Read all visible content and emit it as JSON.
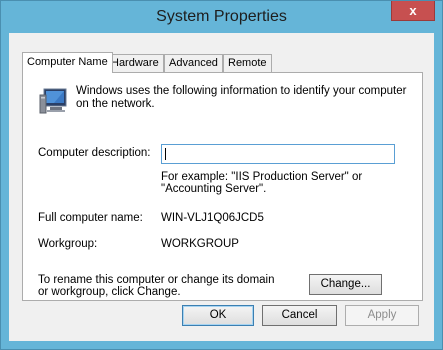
{
  "window": {
    "title": "System Properties",
    "close_label": "x"
  },
  "tabs": [
    {
      "label": "Computer Name",
      "active": true
    },
    {
      "label": "Hardware",
      "active": false
    },
    {
      "label": "Advanced",
      "active": false
    },
    {
      "label": "Remote",
      "active": false
    }
  ],
  "panel": {
    "intro": "Windows uses the following information to identify your computer on the network.",
    "description_label": "Computer description:",
    "description_value": "",
    "example_text": "For example: \"IIS Production Server\" or \"Accounting Server\".",
    "full_name_label": "Full computer name:",
    "full_name_value": "WIN-VLJ1Q06JCD5",
    "workgroup_label": "Workgroup:",
    "workgroup_value": "WORKGROUP",
    "rename_text": "To rename this computer or change its domain or workgroup, click Change.",
    "change_label": "Change..."
  },
  "buttons": {
    "ok": "OK",
    "cancel": "Cancel",
    "apply": "Apply"
  }
}
